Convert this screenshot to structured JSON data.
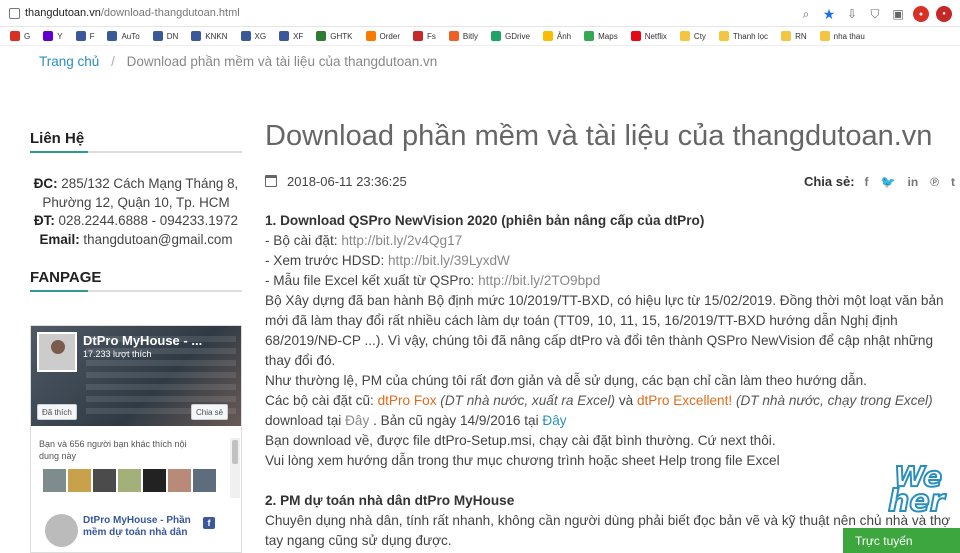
{
  "browser": {
    "url_host": "thangdutoan.vn",
    "url_path": "/download-thangdutoan.html",
    "bookmarks": [
      {
        "label": "G",
        "color": "#d93025"
      },
      {
        "label": "Y",
        "color": "#6001d2"
      },
      {
        "label": "F",
        "color": "#3b5998"
      },
      {
        "label": "AuTo",
        "color": "#3b5998"
      },
      {
        "label": "DN",
        "color": "#3b5998"
      },
      {
        "label": "KNKN",
        "color": "#3b5998"
      },
      {
        "label": "XG",
        "color": "#3b5998"
      },
      {
        "label": "XF",
        "color": "#3b5998"
      },
      {
        "label": "GHTK",
        "color": "#2e7d32"
      },
      {
        "label": "Order",
        "color": "#f57c00"
      },
      {
        "label": "Fs",
        "color": "#c62828"
      },
      {
        "label": "Bitly",
        "color": "#ee6123"
      },
      {
        "label": "GDrive",
        "color": "#1fa463"
      },
      {
        "label": "Ảnh",
        "color": "#fbbc04"
      },
      {
        "label": "Maps",
        "color": "#34a853"
      },
      {
        "label": "Netflix",
        "color": "#e50914"
      },
      {
        "label": "Cty",
        "color": "#f4c542"
      },
      {
        "label": "Thanh lọc",
        "color": "#f4c542"
      },
      {
        "label": "RN",
        "color": "#f4c542"
      },
      {
        "label": "nha thau",
        "color": "#f4c542"
      }
    ]
  },
  "breadcrumb": {
    "home": "Trang chủ",
    "separator": "/",
    "current": "Download phần mềm và tài liệu của thangdutoan.vn"
  },
  "sidebar": {
    "contact_title": "Liên Hệ",
    "address_label": "ĐC:",
    "address": "285/132 Cách Mạng Tháng 8, Phường 12, Quận 10, Tp. HCM",
    "phone_label": "ĐT:",
    "phone": "028.2244.6888 - 094233.1972",
    "email_label": "Email:",
    "email": "thangdutoan@gmail.com",
    "fanpage_title": "FANPAGE",
    "fb": {
      "page_name": "DtPro MyHouse - ...",
      "likes": "17.233 lượt thích",
      "like_button": "Đã thích",
      "share_button": "Chia sẻ",
      "friends_text": "Bạn và 656 người bạn khác thích nội dung này",
      "post_title": "DtPro MyHouse - Phần mềm dự toán nhà dân"
    }
  },
  "post": {
    "title": "Download phần mềm và tài liệu của thangdutoan.vn",
    "date": "2018-06-11 23:36:25",
    "share_label": "Chia sẻ:",
    "share_icons": [
      {
        "name": "facebook-icon",
        "glyph": "f"
      },
      {
        "name": "twitter-icon",
        "glyph": "🐦"
      },
      {
        "name": "linkedin-icon",
        "glyph": "in"
      },
      {
        "name": "pinterest-icon",
        "glyph": "℗"
      },
      {
        "name": "tumblr-icon",
        "glyph": "t"
      }
    ],
    "section1_heading": "1. Download QSPro NewVision 2020 (phiên bản nâng cấp của dtPro)",
    "install_label": "- Bộ cài đặt: ",
    "install_link": "http://bit.ly/2v4Qg17",
    "guide_label": "- Xem trước HDSD: ",
    "guide_link": "http://bit.ly/39LyxdW",
    "excel_label": "- Mẫu file Excel kết xuất từ QSPro: ",
    "excel_link": "http://bit.ly/2TO9bpd",
    "para1": "Bộ Xây dựng đã ban hành Bộ định mức 10/2019/TT-BXD, có hiệu lực từ 15/02/2019. Đồng thời một loạt văn bản mới đã làm thay đổi rất nhiều cách làm dự toán (TT09, 10, 11, 15, 16/2019/TT-BXD hướng dẫn Nghị định 68/2019/NĐ-CP ...). Vì vậy, chúng tôi đã nâng cấp dtPro và đổi tên thành QSPro NewVision để cập nhật những thay đổi đó.",
    "para2": "Như thường lệ, PM của chúng tôi rất đơn giản và dễ sử dụng, các bạn chỉ cần làm theo hướng dẫn.",
    "old_pkgs_prefix": "Các bộ cài đặt cũ: ",
    "fox_name": "dtPro Fox",
    "fox_desc": " (DT nhà nước, xuất ra Excel)",
    "and_word": " và ",
    "excellent_name": "dtPro Excellent!",
    "excellent_desc": " (DT nhà nước, chạy trong Excel)",
    "download_at": "download tại ",
    "here1": "Đây",
    "old_version": " . Bản cũ ngày 14/9/2016 tại ",
    "here2": "Đây",
    "para3": "Bạn download về, được file dtPro-Setup.msi, chạy cài đặt bình thường. Cứ next thôi.",
    "para4": "Vui lòng xem hướng dẫn trong thư mục chương trình hoặc sheet Help trong file Excel",
    "section2_heading": "2. PM dự toán nhà dân dtPro MyHouse",
    "section2_text": "Chuyên dụng nhà dân, tính rất nhanh, không cần người dùng phải biết đọc bản vẽ và kỹ thuật nên chủ nhà và thợ tay ngang cũng sử dụng được."
  },
  "overlay": {
    "weare_line1": "We",
    "weare_line2": "her",
    "chat_label": "Trực tuyến"
  }
}
